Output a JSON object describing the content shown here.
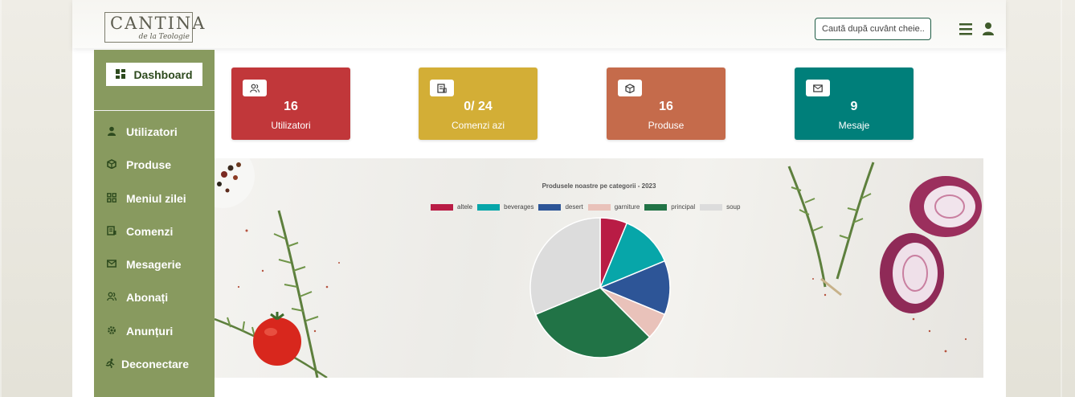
{
  "header": {
    "logo_main": "CANTINA",
    "logo_sub": "de la Teologie",
    "search_placeholder": "Caută după cuvânt cheie..."
  },
  "sidebar": {
    "dashboard_label": "Dashboard",
    "items": [
      {
        "label": "Utilizatori",
        "icon": "user-icon"
      },
      {
        "label": "Produse",
        "icon": "box-icon"
      },
      {
        "label": "Meniul zilei",
        "icon": "grid-icon"
      },
      {
        "label": "Comenzi",
        "icon": "receipt-icon"
      },
      {
        "label": "Mesagerie",
        "icon": "envelope-icon"
      },
      {
        "label": "Abonați",
        "icon": "users-icon"
      },
      {
        "label": "Anunțuri",
        "icon": "gear-icon"
      },
      {
        "label": "Deconectare",
        "icon": "running-icon"
      }
    ]
  },
  "cards": [
    {
      "value": "16",
      "label": "Utilizatori",
      "color": "#c1373a",
      "icon": "users-icon"
    },
    {
      "value": "0/ 24",
      "label": "Comenzi azi",
      "color": "#d3ae36",
      "icon": "receipt-icon"
    },
    {
      "value": "16",
      "label": "Produse",
      "color": "#c56b4b",
      "icon": "box-icon"
    },
    {
      "value": "9",
      "label": "Mesaje",
      "color": "#007f7a",
      "icon": "envelope-icon"
    }
  ],
  "colors": {
    "sidebar": "#889a5f",
    "accent_dark": "#2d4a1e"
  },
  "chart_data": {
    "type": "pie",
    "title": "Produsele noastre pe categorii - 2023",
    "legend_position": "top",
    "categories": [
      "altele",
      "beverages",
      "desert",
      "garniture",
      "principal",
      "soup"
    ],
    "values": [
      1,
      2,
      2,
      1,
      5,
      5
    ],
    "colors": [
      "#b91c45",
      "#07a6a9",
      "#2d5597",
      "#e9c2ba",
      "#217346",
      "#dcdcdc"
    ]
  }
}
